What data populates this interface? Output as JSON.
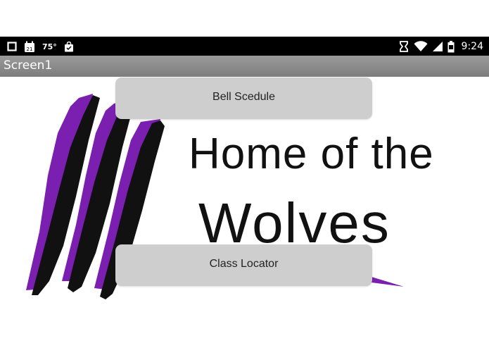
{
  "status_bar": {
    "temperature": "75°",
    "time": "9:24",
    "icons": [
      "square-notification-icon",
      "calendar-icon",
      "shopping-bag-icon",
      "vibrate-icon",
      "wifi-icon",
      "cell-signal-icon",
      "battery-icon"
    ],
    "calendar_day": "21"
  },
  "title_bar": {
    "title": "Screen1"
  },
  "logo": {
    "line1": "Home of the",
    "line2": "Wolves",
    "accent_color": "#7a1fb0"
  },
  "buttons": {
    "bell_schedule": "Bell Scedule",
    "class_locator": "Class Locator"
  }
}
